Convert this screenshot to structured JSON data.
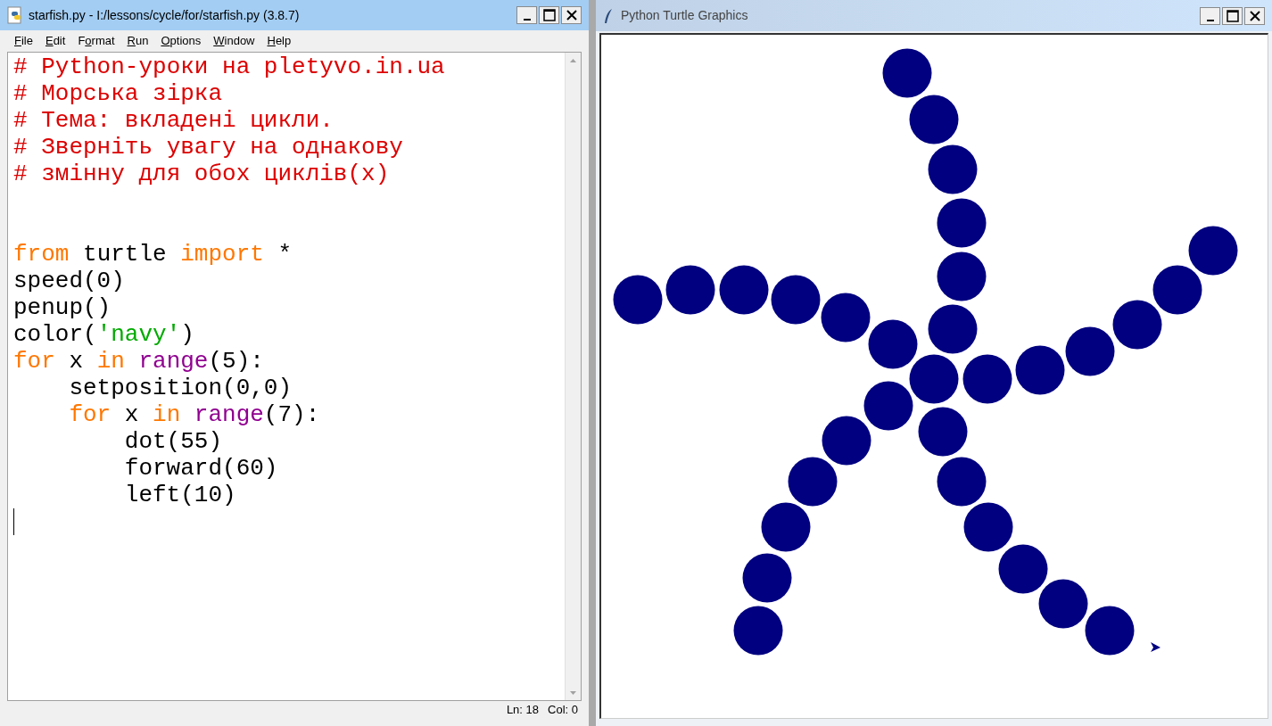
{
  "editor": {
    "title": "starfish.py - I:/lessons/cycle/for/starfish.py (3.8.7)",
    "menu": [
      {
        "key": "F",
        "post": "ile"
      },
      {
        "key": "E",
        "post": "dit"
      },
      {
        "pre": "F",
        "key": "o",
        "post": "rmat"
      },
      {
        "key": "R",
        "post": "un"
      },
      {
        "key": "O",
        "post": "ptions"
      },
      {
        "key": "W",
        "post": "indow"
      },
      {
        "key": "H",
        "post": "elp"
      }
    ],
    "lines": [
      {
        "kind": "code",
        "tokens": [
          {
            "kind": "comment",
            "text": "# Python-уроки на pletyvo.in.ua"
          }
        ]
      },
      {
        "kind": "code",
        "tokens": [
          {
            "kind": "comment",
            "text": "# Морська зірка"
          }
        ]
      },
      {
        "kind": "code",
        "tokens": [
          {
            "kind": "comment",
            "text": "# Тема: вкладені цикли."
          }
        ]
      },
      {
        "kind": "code",
        "tokens": [
          {
            "kind": "comment",
            "text": "# Зверніть увагу на однакову"
          }
        ]
      },
      {
        "kind": "code",
        "tokens": [
          {
            "kind": "comment",
            "text": "# змінну для обох циклів(x)"
          }
        ]
      },
      {
        "kind": "blank"
      },
      {
        "kind": "blank"
      },
      {
        "kind": "code",
        "tokens": [
          {
            "kind": "keyword",
            "text": "from"
          },
          {
            "kind": "plain",
            "text": " turtle "
          },
          {
            "kind": "keyword",
            "text": "import"
          },
          {
            "kind": "plain",
            "text": " *"
          }
        ]
      },
      {
        "kind": "code",
        "tokens": [
          {
            "kind": "plain",
            "text": "speed(0)"
          }
        ]
      },
      {
        "kind": "code",
        "tokens": [
          {
            "kind": "plain",
            "text": "penup()"
          }
        ]
      },
      {
        "kind": "code",
        "tokens": [
          {
            "kind": "plain",
            "text": "color("
          },
          {
            "kind": "string",
            "text": "'navy'"
          },
          {
            "kind": "plain",
            "text": ")"
          }
        ]
      },
      {
        "kind": "code",
        "tokens": [
          {
            "kind": "keyword",
            "text": "for"
          },
          {
            "kind": "plain",
            "text": " x "
          },
          {
            "kind": "keyword",
            "text": "in"
          },
          {
            "kind": "builtin",
            "text": "range",
            "space_before": true
          },
          {
            "kind": "plain",
            "text": "(5):"
          }
        ]
      },
      {
        "kind": "indented",
        "tokens": [
          {
            "kind": "plain",
            "text": "setposition(0,0)"
          }
        ]
      },
      {
        "kind": "indented",
        "tokens": [
          {
            "kind": "keyword",
            "text": "for"
          },
          {
            "kind": "plain",
            "text": " x "
          },
          {
            "kind": "keyword",
            "text": "in"
          },
          {
            "kind": "builtin",
            "text": "range",
            "space_before": true
          },
          {
            "kind": "plain",
            "text": "(7):"
          }
        ]
      },
      {
        "kind": "indented2",
        "tokens": [
          {
            "kind": "plain",
            "text": "dot(55)"
          }
        ]
      },
      {
        "kind": "indented2",
        "tokens": [
          {
            "kind": "plain",
            "text": "forward(60)"
          }
        ]
      },
      {
        "kind": "indented2",
        "tokens": [
          {
            "kind": "plain",
            "text": "left(10)"
          }
        ]
      },
      {
        "kind": "cursor"
      }
    ],
    "status": {
      "line": "Ln: 18",
      "col": "Col: 0"
    }
  },
  "turtle": {
    "title": "Python Turtle Graphics"
  }
}
